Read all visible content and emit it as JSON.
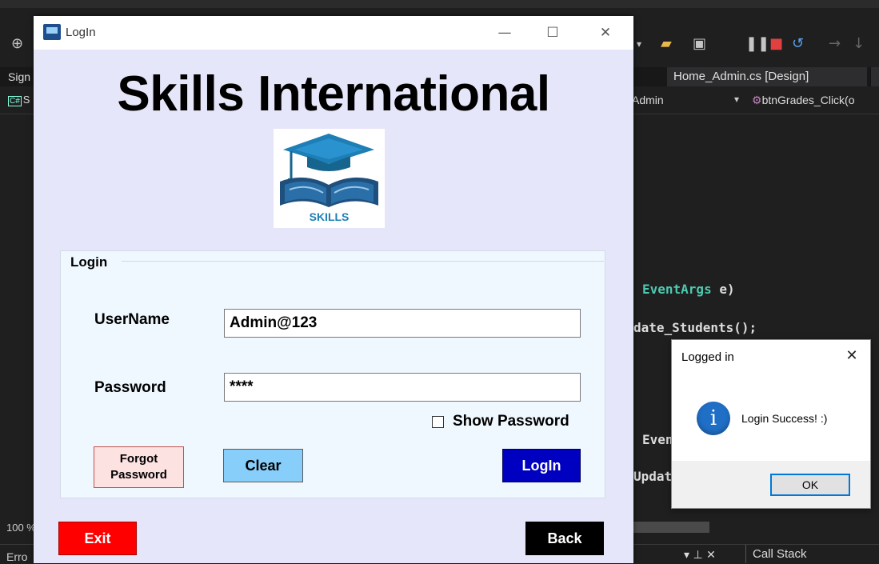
{
  "ide": {
    "tab_left_label": "Sign",
    "tab_home_label": "Home_Admin.cs [Design]",
    "nav_left_label": "S",
    "nav_class": "Admin",
    "nav_method": "btnGrades_Click(o",
    "code_line1_type": "EventArgs",
    "code_line1_rest": " e)",
    "code_line2": "date_Students();",
    "code_line3": "Even",
    "code_line4": "Updat",
    "zoom_text": "100 %",
    "errors_text": "Erro",
    "callstack_label": "Call Stack",
    "icons": [
      "globe-icon",
      "folder-icon",
      "window-icon",
      "pause-icon",
      "stop-icon",
      "restart-icon",
      "step-icon"
    ]
  },
  "login_window": {
    "title": "LogIn",
    "heading": "Skills International",
    "logo_text": "SKILLS",
    "group_title": "Login",
    "username_label": "UserName",
    "username_value": "Admin@123",
    "password_label": "Password",
    "password_value": "****",
    "show_password_label": "Show Password",
    "show_password_checked": false,
    "forgot_line1": "Forgot",
    "forgot_line2": "Password",
    "clear_label": "Clear",
    "login_label": "LogIn",
    "exit_label": "Exit",
    "back_label": "Back",
    "colors": {
      "window_bg": "#e6e6fa",
      "group_bg": "#f0f8ff",
      "forgot_bg": "#fde2e2",
      "clear_bg": "#87cefa",
      "login_bg": "#0000c0",
      "exit_bg": "#ff0000",
      "back_bg": "#000000"
    }
  },
  "message_box": {
    "title": "Logged in",
    "message": "Login Success! :)",
    "ok_label": "OK",
    "icon": "info-icon"
  }
}
